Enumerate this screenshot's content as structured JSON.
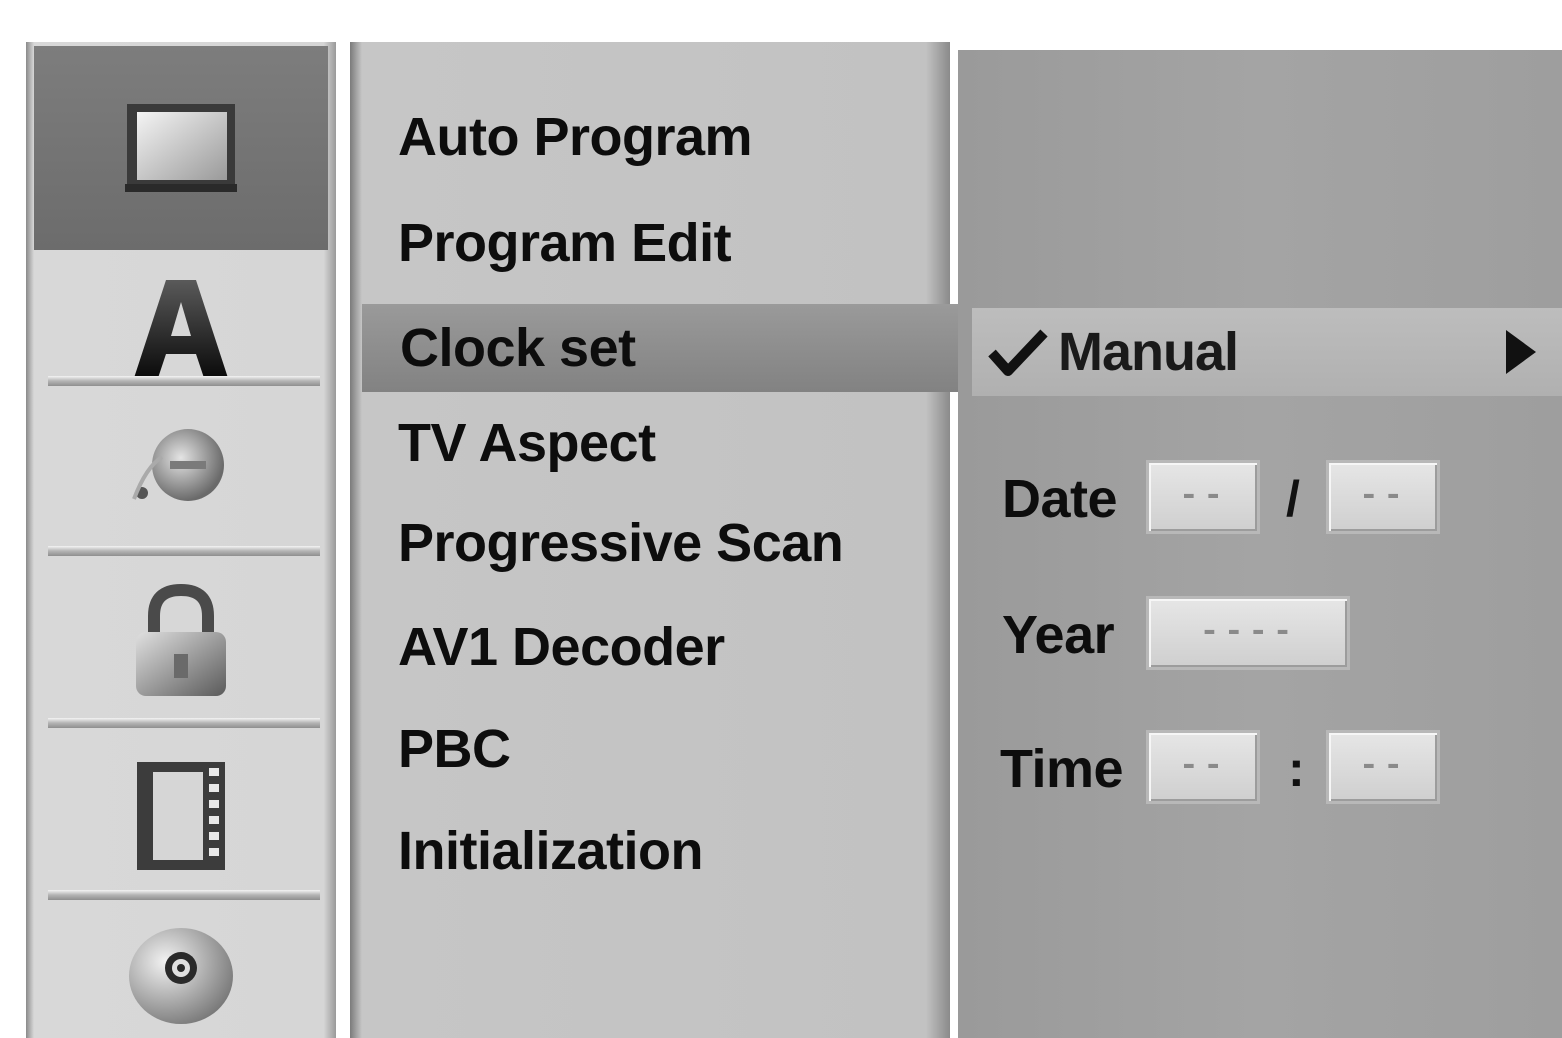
{
  "sidebar": {
    "icons": [
      {
        "name": "tv-icon",
        "selected": true
      },
      {
        "name": "language-icon",
        "selected": false
      },
      {
        "name": "audio-icon",
        "selected": false
      },
      {
        "name": "lock-icon",
        "selected": false
      },
      {
        "name": "film-icon",
        "selected": false
      },
      {
        "name": "disc-icon",
        "selected": false
      }
    ]
  },
  "menu": {
    "items": [
      {
        "label": "Auto Program"
      },
      {
        "label": "Program Edit"
      },
      {
        "label": "Clock set",
        "highlighted": true
      },
      {
        "label": "TV Aspect"
      },
      {
        "label": "Progressive Scan"
      },
      {
        "label": "AV1 Decoder"
      },
      {
        "label": "PBC"
      },
      {
        "label": "Initialization"
      }
    ]
  },
  "clock": {
    "option": "Manual",
    "check_icon": "checkmark-icon",
    "arrow_icon": "arrow-right-icon",
    "date_label": "Date",
    "date_day": "--",
    "date_sep": "/",
    "date_month": "--",
    "year_label": "Year",
    "year_value": "----",
    "time_label": "Time",
    "time_hour": "--",
    "time_sep": ":",
    "time_minute": "--"
  },
  "colors": {
    "selected_icon_bg": "#737373",
    "menu_highlight": "#8c8c8c",
    "panel_bg": "#a0a0a0"
  }
}
